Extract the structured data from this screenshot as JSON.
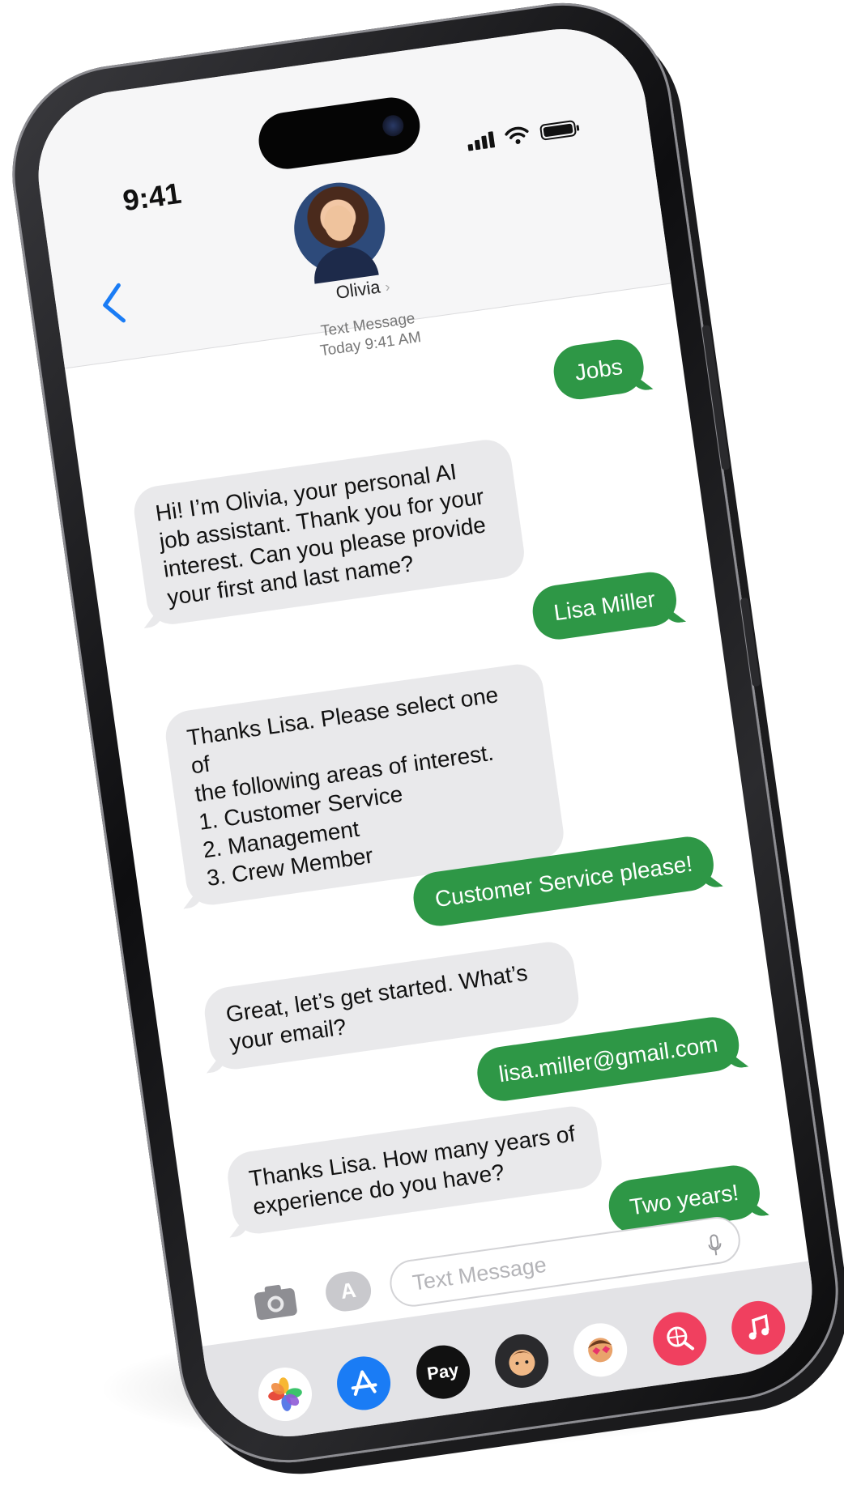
{
  "status": {
    "time": "9:41"
  },
  "contact": {
    "name": "Olivia",
    "chevron": "›"
  },
  "thread": {
    "service": "Text Message",
    "date": "Today 9:41 AM"
  },
  "messages": [
    {
      "from": "me",
      "text": "Jobs"
    },
    {
      "from": "them",
      "text": "Hi! I’m Olivia, your personal AI\njob assistant. Thank you for your\ninterest. Can you please provide\nyour first and last name?"
    },
    {
      "from": "me",
      "text": "Lisa Miller"
    },
    {
      "from": "them",
      "text": "Thanks Lisa. Please select one of\nthe following areas of interest.\n1. Customer Service\n2. Management\n3. Crew Member"
    },
    {
      "from": "me",
      "text": "Customer Service please!"
    },
    {
      "from": "them",
      "text": "Great, let’s get started. What’s\nyour email?"
    },
    {
      "from": "me",
      "text": "lisa.miller@gmail.com"
    },
    {
      "from": "them",
      "text": "Thanks Lisa. How many years of\nexperience do you have?"
    },
    {
      "from": "me",
      "text": "Two years!"
    }
  ],
  "input": {
    "placeholder": "Text Message"
  },
  "apps": [
    {
      "name": "photos-icon",
      "label": ""
    },
    {
      "name": "app-store-icon",
      "label": ""
    },
    {
      "name": "apple-pay-icon",
      "label": "Pay"
    },
    {
      "name": "memoji-icon",
      "label": ""
    },
    {
      "name": "memoji-stickers-icon",
      "label": ""
    },
    {
      "name": "web-images-icon",
      "label": ""
    },
    {
      "name": "music-icon",
      "label": ""
    }
  ],
  "colors": {
    "outgoing": "#2e9746",
    "incoming": "#e9e9eb",
    "link": "#1a7cf5"
  }
}
